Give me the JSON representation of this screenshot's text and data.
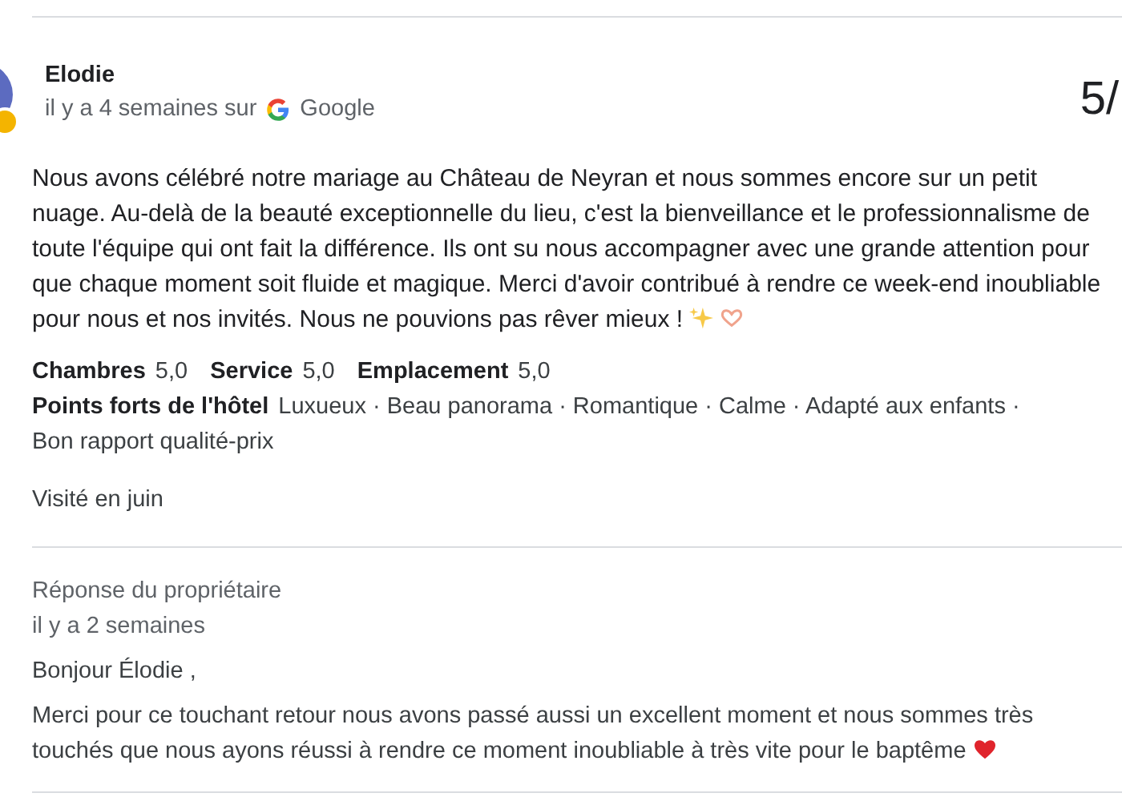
{
  "review": {
    "author": "Elodie",
    "time": "il y a 4 semaines sur",
    "source": "Google",
    "score": "5/",
    "text": "Nous avons célébré notre mariage au Château de Neyran et nous sommes encore sur un petit nuage. Au-delà de la beauté exceptionnelle du lieu, c'est la bienveillance et le professionnalisme de toute l'équipe qui ont fait la différence. Ils ont su nous accompagner avec une grande attention pour que chaque moment soit fluide et magique. Merci d'avoir contribué à rendre ce week-end inoubliable pour nous et nos invités. Nous ne pouvions pas rêver mieux !",
    "ratings": [
      {
        "label": "Chambres",
        "value": "5,0"
      },
      {
        "label": "Service",
        "value": "5,0"
      },
      {
        "label": "Emplacement",
        "value": "5,0"
      }
    ],
    "highlights": {
      "label": "Points forts de l'hôtel",
      "values": [
        "Luxueux · Beau panorama · Romantique · Calme · Adapté aux enfants ·",
        "Bon rapport qualité-prix"
      ]
    },
    "visited": "Visité en juin"
  },
  "owner_reply": {
    "title": "Réponse du propriétaire",
    "time": "il y a 2 semaines",
    "greeting": "Bonjour Élodie ,",
    "text": "Merci pour ce touchant retour nous avons passé aussi un excellent moment et nous sommes très touchés que nous ayons réussi à rendre ce moment inoubliable à très vite pour le baptême"
  }
}
